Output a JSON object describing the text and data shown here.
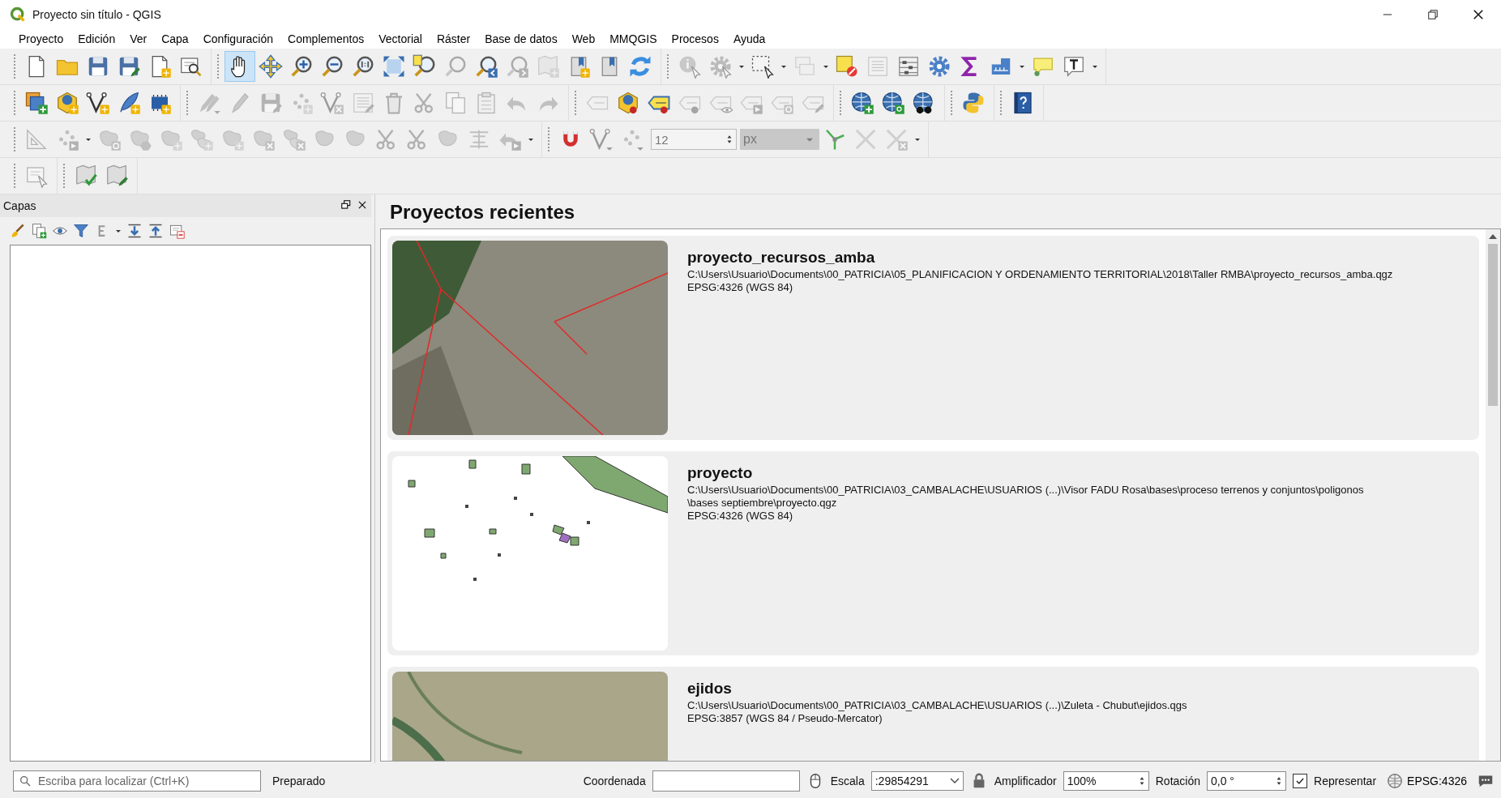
{
  "window": {
    "title": "Proyecto sin título - QGIS"
  },
  "menu": [
    "Proyecto",
    "Edición",
    "Ver",
    "Capa",
    "Configuración",
    "Complementos",
    "Vectorial",
    "Ráster",
    "Base de datos",
    "Web",
    "MMQGIS",
    "Procesos",
    "Ayuda"
  ],
  "toolbars": [
    {
      "groups": [
        [
          {
            "kind": "page",
            "selected": false,
            "disabled": false
          },
          {
            "kind": "folder",
            "selected": false,
            "disabled": false
          },
          {
            "kind": "disk",
            "selected": false,
            "disabled": false
          },
          {
            "kind": "disk-pencil",
            "selected": false,
            "disabled": false
          },
          {
            "kind": "page-star",
            "selected": false,
            "disabled": false
          },
          {
            "kind": "frame-magnifier",
            "selected": false,
            "disabled": false
          }
        ],
        [
          {
            "kind": "hand",
            "selected": true,
            "disabled": false
          },
          {
            "kind": "arrows",
            "selected": false,
            "disabled": false
          },
          {
            "kind": "magnifier-in",
            "selected": false,
            "disabled": false
          },
          {
            "kind": "magnifier-out",
            "selected": false,
            "disabled": false
          },
          {
            "kind": "magnifier-one",
            "selected": false,
            "disabled": false
          },
          {
            "kind": "extent",
            "selected": false,
            "disabled": false
          },
          {
            "kind": "magnifier-page",
            "selected": false,
            "disabled": false
          },
          {
            "kind": "magnifier",
            "selected": false,
            "disabled": true
          },
          {
            "kind": "magnifier-left",
            "selected": false,
            "disabled": false
          },
          {
            "kind": "magnifier-right",
            "selected": false,
            "disabled": true
          },
          {
            "kind": "map-star",
            "selected": false,
            "disabled": true
          },
          {
            "kind": "bookmark-star",
            "selected": false,
            "disabled": false
          },
          {
            "kind": "bookmark",
            "selected": false,
            "disabled": false
          },
          {
            "kind": "refresh",
            "selected": false,
            "disabled": false
          }
        ],
        [
          {
            "kind": "info-cursor",
            "selected": false,
            "disabled": true
          },
          {
            "kind": "gear-cursor",
            "selected": false,
            "disabled": true
          },
          {
            "kind": "caret",
            "selected": false,
            "disabled": false
          },
          {
            "kind": "select-cursor",
            "selected": false,
            "disabled": false
          },
          {
            "kind": "caret",
            "selected": false,
            "disabled": false
          },
          {
            "kind": "boxes",
            "selected": false,
            "disabled": true
          },
          {
            "kind": "caret",
            "selected": false,
            "disabled": false
          },
          {
            "kind": "square-forbid",
            "selected": false,
            "disabled": false
          },
          {
            "kind": "table",
            "selected": false,
            "disabled": true
          },
          {
            "kind": "abacus",
            "selected": false,
            "disabled": false
          },
          {
            "kind": "gear",
            "selected": false,
            "disabled": false
          },
          {
            "kind": "sigma",
            "selected": false,
            "disabled": false
          },
          {
            "kind": "ruler",
            "selected": false,
            "disabled": false
          },
          {
            "kind": "caret",
            "selected": false,
            "disabled": false
          },
          {
            "kind": "bubble",
            "selected": false,
            "disabled": false
          },
          {
            "kind": "textbox",
            "selected": false,
            "disabled": false
          },
          {
            "kind": "caret",
            "selected": false,
            "disabled": false
          }
        ]
      ]
    },
    {
      "groups": [
        [
          {
            "kind": "layers-plus",
            "selected": false,
            "disabled": false
          },
          {
            "kind": "cube-star",
            "selected": false,
            "disabled": false
          },
          {
            "kind": "vertex-star",
            "selected": false,
            "disabled": false
          },
          {
            "kind": "feather-star",
            "selected": false,
            "disabled": false
          },
          {
            "kind": "chip-star",
            "selected": false,
            "disabled": false
          }
        ],
        [
          {
            "kind": "pencils-dot",
            "selected": false,
            "disabled": true
          },
          {
            "kind": "pencil",
            "selected": false,
            "disabled": true
          },
          {
            "kind": "disk-pencil",
            "selected": false,
            "disabled": true
          },
          {
            "kind": "dots-star",
            "selected": false,
            "disabled": true
          },
          {
            "kind": "vertex-x",
            "selected": false,
            "disabled": true
          },
          {
            "kind": "table-pencil",
            "selected": false,
            "disabled": true
          },
          {
            "kind": "trash",
            "selected": false,
            "disabled": true
          },
          {
            "kind": "scissors",
            "selected": false,
            "disabled": true
          },
          {
            "kind": "copy",
            "selected": false,
            "disabled": true
          },
          {
            "kind": "paste",
            "selected": false,
            "disabled": true
          },
          {
            "kind": "undo",
            "selected": false,
            "disabled": true
          },
          {
            "kind": "redo",
            "selected": false,
            "disabled": true
          }
        ],
        [
          {
            "kind": "tag",
            "selected": false,
            "disabled": true
          },
          {
            "kind": "cube-pin",
            "selected": false,
            "disabled": false
          },
          {
            "kind": "tagsel-pin",
            "selected": false,
            "disabled": false
          },
          {
            "kind": "tag-pin",
            "selected": false,
            "disabled": true
          },
          {
            "kind": "tag-eye",
            "selected": false,
            "disabled": true
          },
          {
            "kind": "tag-arrow",
            "selected": false,
            "disabled": true
          },
          {
            "kind": "tag-rotate",
            "selected": false,
            "disabled": true
          },
          {
            "kind": "tag-pencil",
            "selected": false,
            "disabled": true
          }
        ],
        [
          {
            "kind": "globe-plus",
            "selected": false,
            "disabled": false
          },
          {
            "kind": "globe-search",
            "selected": false,
            "disabled": false
          },
          {
            "kind": "globe-binoculars",
            "selected": false,
            "disabled": false
          }
        ],
        [
          {
            "kind": "python",
            "selected": false,
            "disabled": false
          }
        ],
        [
          {
            "kind": "book-help",
            "selected": false,
            "disabled": false
          }
        ]
      ]
    },
    {
      "groups": [
        [
          {
            "kind": "setsquare",
            "selected": false,
            "disabled": true
          },
          {
            "kind": "dots-arrow",
            "selected": false,
            "disabled": true
          },
          {
            "kind": "caret",
            "selected": false,
            "disabled": false
          },
          {
            "kind": "blob-rotate",
            "selected": false,
            "disabled": true
          },
          {
            "kind": "blob-hexagon",
            "selected": false,
            "disabled": true
          },
          {
            "kind": "blob-star",
            "selected": false,
            "disabled": true
          },
          {
            "kind": "blobs-star",
            "selected": false,
            "disabled": true
          },
          {
            "kind": "blob-star",
            "selected": false,
            "disabled": true
          },
          {
            "kind": "blob-x",
            "selected": false,
            "disabled": true
          },
          {
            "kind": "blobs-x",
            "selected": false,
            "disabled": true
          },
          {
            "kind": "blob",
            "selected": false,
            "disabled": true
          },
          {
            "kind": "blob",
            "selected": false,
            "disabled": true
          },
          {
            "kind": "scissors",
            "selected": false,
            "disabled": true
          },
          {
            "kind": "scissors",
            "selected": false,
            "disabled": true
          },
          {
            "kind": "blob-split",
            "selected": false,
            "disabled": true
          },
          {
            "kind": "split",
            "selected": false,
            "disabled": true
          },
          {
            "kind": "undo-arrow",
            "selected": false,
            "disabled": true
          },
          {
            "kind": "caret",
            "selected": false,
            "disabled": false
          }
        ],
        [
          {
            "kind": "magnet",
            "selected": false,
            "disabled": false
          },
          {
            "kind": "vertex-caret",
            "selected": false,
            "disabled": true
          },
          {
            "kind": "dots-caret",
            "selected": false,
            "disabled": true
          },
          {
            "kind": "spinbox",
            "value": "12",
            "disabled": true
          },
          {
            "kind": "combo",
            "value": "px",
            "disabled": true
          },
          {
            "kind": "snap",
            "selected": false,
            "disabled": false
          },
          {
            "kind": "cross",
            "selected": false,
            "disabled": true
          },
          {
            "kind": "cross-x",
            "selected": false,
            "disabled": true
          },
          {
            "kind": "caret",
            "selected": false,
            "disabled": false
          }
        ]
      ]
    },
    {
      "groups": [
        [
          {
            "kind": "frame-cursor",
            "selected": false,
            "disabled": true
          }
        ],
        [
          {
            "kind": "map-mark",
            "selected": false,
            "disabled": false
          },
          {
            "kind": "map-pencil",
            "selected": false,
            "disabled": false
          }
        ]
      ]
    }
  ],
  "layers_panel": {
    "title": "Capas",
    "tools": [
      {
        "kind": "brush"
      },
      {
        "kind": "copy-plus"
      },
      {
        "kind": "eye"
      },
      {
        "kind": "filter"
      },
      {
        "kind": "epsilon"
      },
      {
        "kind": "caret"
      },
      {
        "kind": "expand"
      },
      {
        "kind": "collapse"
      },
      {
        "kind": "frame-minus"
      }
    ]
  },
  "recent": {
    "heading": "Proyectos recientes",
    "projects": [
      {
        "kind": "satellite",
        "name": "proyecto_recursos_amba",
        "path": [
          "C:\\Users\\Usuario\\Documents\\00_PATRICIA\\05_PLANIFICACION Y ORDENAMIENTO TERRITORIAL\\2018\\Taller RMBA\\proyecto_recursos_amba.qgz"
        ],
        "crs": "EPSG:4326 (WGS 84)"
      },
      {
        "kind": "vector",
        "name": "proyecto",
        "path": [
          "C:\\Users\\Usuario\\Documents\\00_PATRICIA\\03_CAMBALACHE\\USUARIOS (...)\\Visor FADU Rosa\\bases\\proceso terrenos y conjuntos\\poligonos",
          "\\bases septiembre\\proyecto.qgz"
        ],
        "crs": "EPSG:4326 (WGS 84)"
      },
      {
        "kind": "terrain",
        "name": "ejidos",
        "path": [
          "C:\\Users\\Usuario\\Documents\\00_PATRICIA\\03_CAMBALACHE\\USUARIOS (...)\\Zuleta - Chubut\\ejidos.qgs"
        ],
        "crs": "EPSG:3857 (WGS 84 / Pseudo-Mercator)"
      }
    ]
  },
  "status_bar": {
    "locator": {
      "placeholder": "Escriba para localizar (Ctrl+K)"
    },
    "message": "Preparado",
    "coordinate_label": "Coordenada",
    "scale_label": "Escala",
    "scale": ":29854291",
    "magnifier_label": "Amplificador",
    "magnifier": "100%",
    "rotation_label": "Rotación",
    "rotation": "0,0 °",
    "render": {
      "label": "Representar",
      "checked": true
    },
    "crs": "EPSG:4326"
  }
}
